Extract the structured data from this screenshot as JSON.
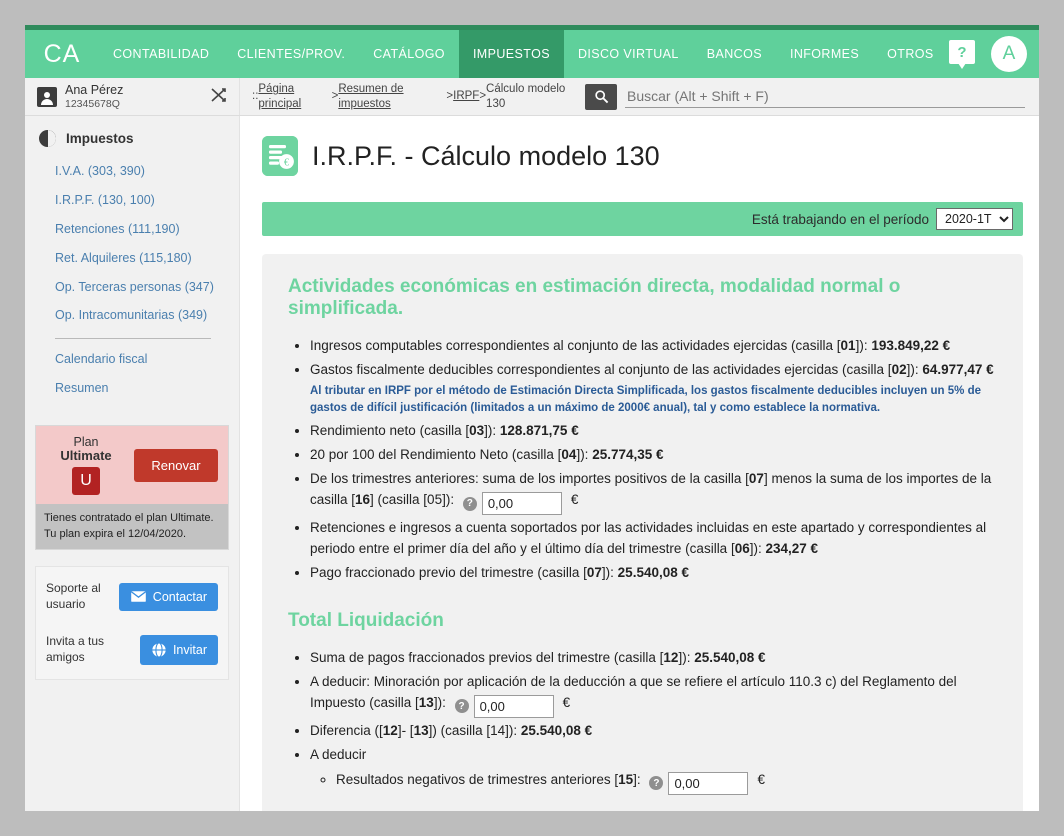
{
  "nav": {
    "brand": "CA",
    "items": [
      {
        "label": "CONTABILIDAD",
        "active": false
      },
      {
        "label": "CLIENTES/PROV.",
        "active": false
      },
      {
        "label": "CATÁLOGO",
        "active": false
      },
      {
        "label": "IMPUESTOS",
        "active": true
      },
      {
        "label": "DISCO VIRTUAL",
        "active": false
      },
      {
        "label": "BANCOS",
        "active": false
      },
      {
        "label": "INFORMES",
        "active": false
      },
      {
        "label": "OTROS",
        "active": false
      }
    ],
    "help_icon": "help-question-icon",
    "help_glyph": "?",
    "avatar_letter": "A",
    "accent_green": "#5fd09b",
    "active_green": "#349a68"
  },
  "user": {
    "name": "Ana Pérez",
    "id": "12345678Q",
    "switch_icon": "shuffle-icon",
    "switch_glyph": "⤫"
  },
  "breadcrumb": {
    "prefix": ":: ",
    "items": [
      "Página principal",
      "Resumen de impuestos",
      "IRPF",
      "Cálculo modelo 130"
    ],
    "separator": " > "
  },
  "search": {
    "placeholder": "Buscar (Alt + Shift + F)",
    "value": "",
    "icon": "search-icon",
    "icon_glyph": "🔍"
  },
  "sidebar": {
    "section_title": "Impuestos",
    "section_icon": "pie-chart-icon",
    "links": [
      "I.V.A. (303, 390)",
      "I.R.P.F. (130, 100)",
      "Retenciones (111,190)",
      "Ret. Alquileres (115,180)",
      "Op. Terceras personas (347)",
      "Op. Intracomunitarias (349)"
    ],
    "links_after_separator": [
      "Calendario fiscal",
      "Resumen"
    ],
    "plan": {
      "line1": "Plan",
      "line2": "Ultimate",
      "badge": "U",
      "button": "Renovar",
      "note": "Tienes contratado el plan Ultimate. Tu plan expira el 12/04/2020.",
      "bg": "#f3c9c9",
      "button_color": "#c0392b"
    },
    "support": {
      "label": "Soporte al usuario",
      "button": "Contactar",
      "icon": "envelope-icon"
    },
    "invite": {
      "label": "Invita a tus amigos",
      "button": "Invitar",
      "icon": "globe-icon"
    }
  },
  "main": {
    "title": "I.R.P.F. - Cálculo modelo 130",
    "title_icon": "tax-document-euro-icon",
    "period": {
      "label": "Está trabajando en el período",
      "selected": "2020-1T",
      "options": [
        "2020-1T"
      ]
    },
    "section1": {
      "heading": "Actividades económicas en estimación directa, modalidad normal o simplificada.",
      "items": [
        {
          "text_before": "Ingresos computables correspondientes al conjunto de las actividades ejercidas (casilla [",
          "box": "01",
          "text_after": "]): ",
          "value": "193.849,22 €"
        },
        {
          "text_before": "Gastos fiscalmente deducibles correspondientes al conjunto de las actividades ejercidas (casilla [",
          "box": "02",
          "text_after": "]): ",
          "value": "64.977,47 €",
          "note": "Al tributar en IRPF por el método de Estimación Directa Simplificada, los gastos fiscalmente deducibles incluyen un 5% de gastos de difícil justificación (limitados a un máximo de 2000€ anual), tal y como establece la normativa."
        },
        {
          "text_before": "Rendimiento neto (casilla [",
          "box": "03",
          "text_after": "]): ",
          "value": "128.871,75 €"
        },
        {
          "text_before": "20 por 100 del Rendimiento Neto (casilla [",
          "box": "04",
          "text_after": "]): ",
          "value": "25.774,35 €"
        },
        {
          "text_before": "De los trimestres anteriores: suma de los importes positivos de la casilla [",
          "box": "07",
          "text_mid": "] menos la suma de los importes de la casilla [",
          "box2": "16",
          "text_after": "] (casilla [05]): ",
          "input_value": "0,00",
          "input_suffix": "€",
          "help": "?"
        },
        {
          "text_before": "Retenciones e ingresos a cuenta soportados por las actividades incluidas en este apartado y correspondientes al periodo entre el primer día del año y el último día del trimestre (casilla [",
          "box": "06",
          "text_after": "]): ",
          "value": "234,27 €"
        },
        {
          "text_before": "Pago fraccionado previo del trimestre (casilla [",
          "box": "07",
          "text_after": "]): ",
          "value": "25.540,08 €"
        }
      ]
    },
    "section2": {
      "heading": "Total Liquidación",
      "items": [
        {
          "text_before": "Suma de pagos fraccionados previos del trimestre (casilla [",
          "box": "12",
          "text_after": "]): ",
          "value": "25.540,08 €"
        },
        {
          "text_before": "A deducir: Minoración por aplicación de la deducción a que se refiere el artículo 110.3 c) del Reglamento del Impuesto (casilla [",
          "box": "13",
          "text_after": "]): ",
          "input_value": "0,00",
          "input_suffix": "€",
          "help": "?"
        },
        {
          "text_before": "Diferencia ([",
          "box": "12",
          "text_mid": "]- [",
          "box2": "13",
          "text_after": "]) (casilla [14]): ",
          "value": "25.540,08 €"
        },
        {
          "text_before": "A deducir",
          "sub": [
            {
              "text_before": "Resultados negativos de trimestres anteriores [",
              "box": "15",
              "text_after": "]: ",
              "input_value": "0,00",
              "input_suffix": "€",
              "help": "?"
            }
          ]
        }
      ]
    }
  }
}
